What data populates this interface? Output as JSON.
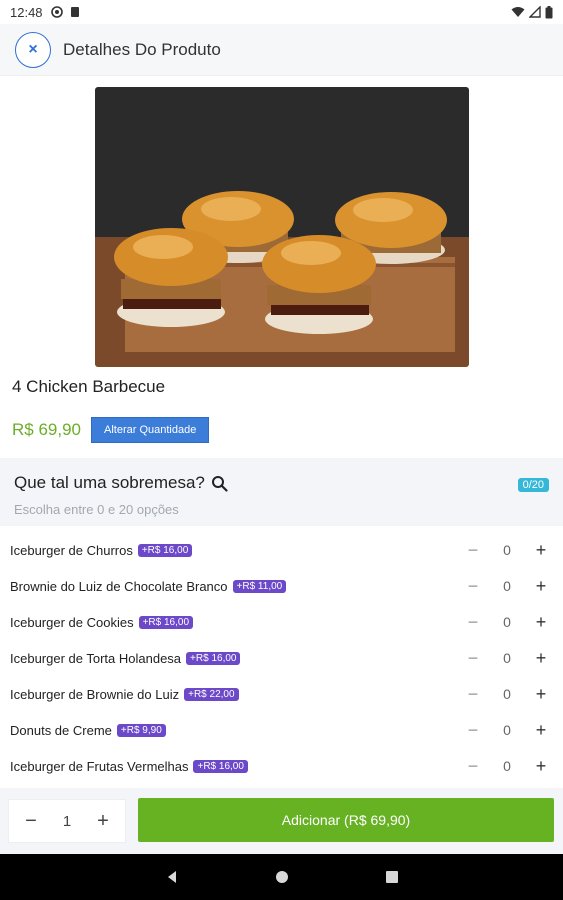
{
  "status_bar": {
    "time": "12:48"
  },
  "header": {
    "title": "Detalhes Do Produto",
    "close_symbol": "×"
  },
  "product": {
    "name": "4 Chicken Barbecue",
    "price": "R$ 69,90",
    "alter_quantity_label": "Alterar Quantidade"
  },
  "section": {
    "title": "Que tal uma sobremesa?",
    "subtitle": "Escolha entre 0 e 20 opções",
    "counter": "0/20"
  },
  "options": [
    {
      "name": "Iceburger de Churros",
      "price": "+R$ 16,00",
      "qty": "0"
    },
    {
      "name": "Brownie do Luiz de Chocolate Branco",
      "price": "+R$ 11,00",
      "qty": "0"
    },
    {
      "name": "Iceburger de Cookies",
      "price": "+R$ 16,00",
      "qty": "0"
    },
    {
      "name": "Iceburger de Torta Holandesa",
      "price": "+R$ 16,00",
      "qty": "0"
    },
    {
      "name": "Iceburger de Brownie do Luiz",
      "price": "+R$ 22,00",
      "qty": "0"
    },
    {
      "name": "Donuts de Creme",
      "price": "+R$ 9,90",
      "qty": "0"
    },
    {
      "name": "Iceburger de Frutas Vermelhas",
      "price": "+R$ 16,00",
      "qty": "0"
    }
  ],
  "stepper": {
    "minus": "−",
    "plus": "+"
  },
  "bottom": {
    "quantity": "1",
    "add_label": "Adicionar (R$ 69,90)"
  },
  "colors": {
    "accent_blue": "#2f6fd6",
    "price_green": "#6cae2a",
    "add_green": "#66b223",
    "badge_purple": "#6b49c8",
    "counter_cyan": "#35b8d8"
  }
}
